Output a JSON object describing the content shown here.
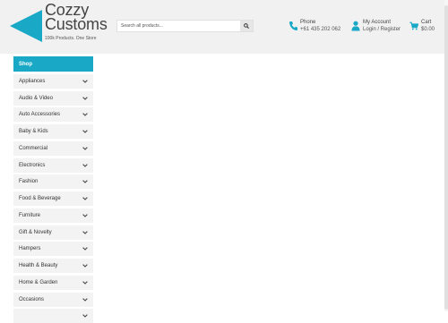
{
  "brand": {
    "name_line1": "Cozzy",
    "name_line2": "Customs",
    "tagline": "100k Products. One Store",
    "accent_color": "#19a8c6"
  },
  "search": {
    "placeholder": "Search all products...",
    "button_icon": "search-icon"
  },
  "phone": {
    "label": "Phone",
    "number": "+61 435 202 062",
    "icon": "phone-icon"
  },
  "account": {
    "label": "My Account",
    "links": "Login / Register",
    "icon": "user-icon"
  },
  "cart": {
    "label": "Cart",
    "total": "$0.00",
    "icon": "cart-icon"
  },
  "sidebar": {
    "title": "Shop",
    "items": [
      {
        "label": "Appliances"
      },
      {
        "label": "Audio & Video"
      },
      {
        "label": "Auto Accessories"
      },
      {
        "label": "Baby & Kids"
      },
      {
        "label": "Commercial"
      },
      {
        "label": "Electronics"
      },
      {
        "label": "Fashion"
      },
      {
        "label": "Food & Beverage"
      },
      {
        "label": "Furniture"
      },
      {
        "label": "Gift & Novelty"
      },
      {
        "label": "Hampers"
      },
      {
        "label": "Health & Beauty"
      },
      {
        "label": "Home & Garden"
      },
      {
        "label": "Occasions"
      },
      {
        "label": ""
      }
    ]
  }
}
